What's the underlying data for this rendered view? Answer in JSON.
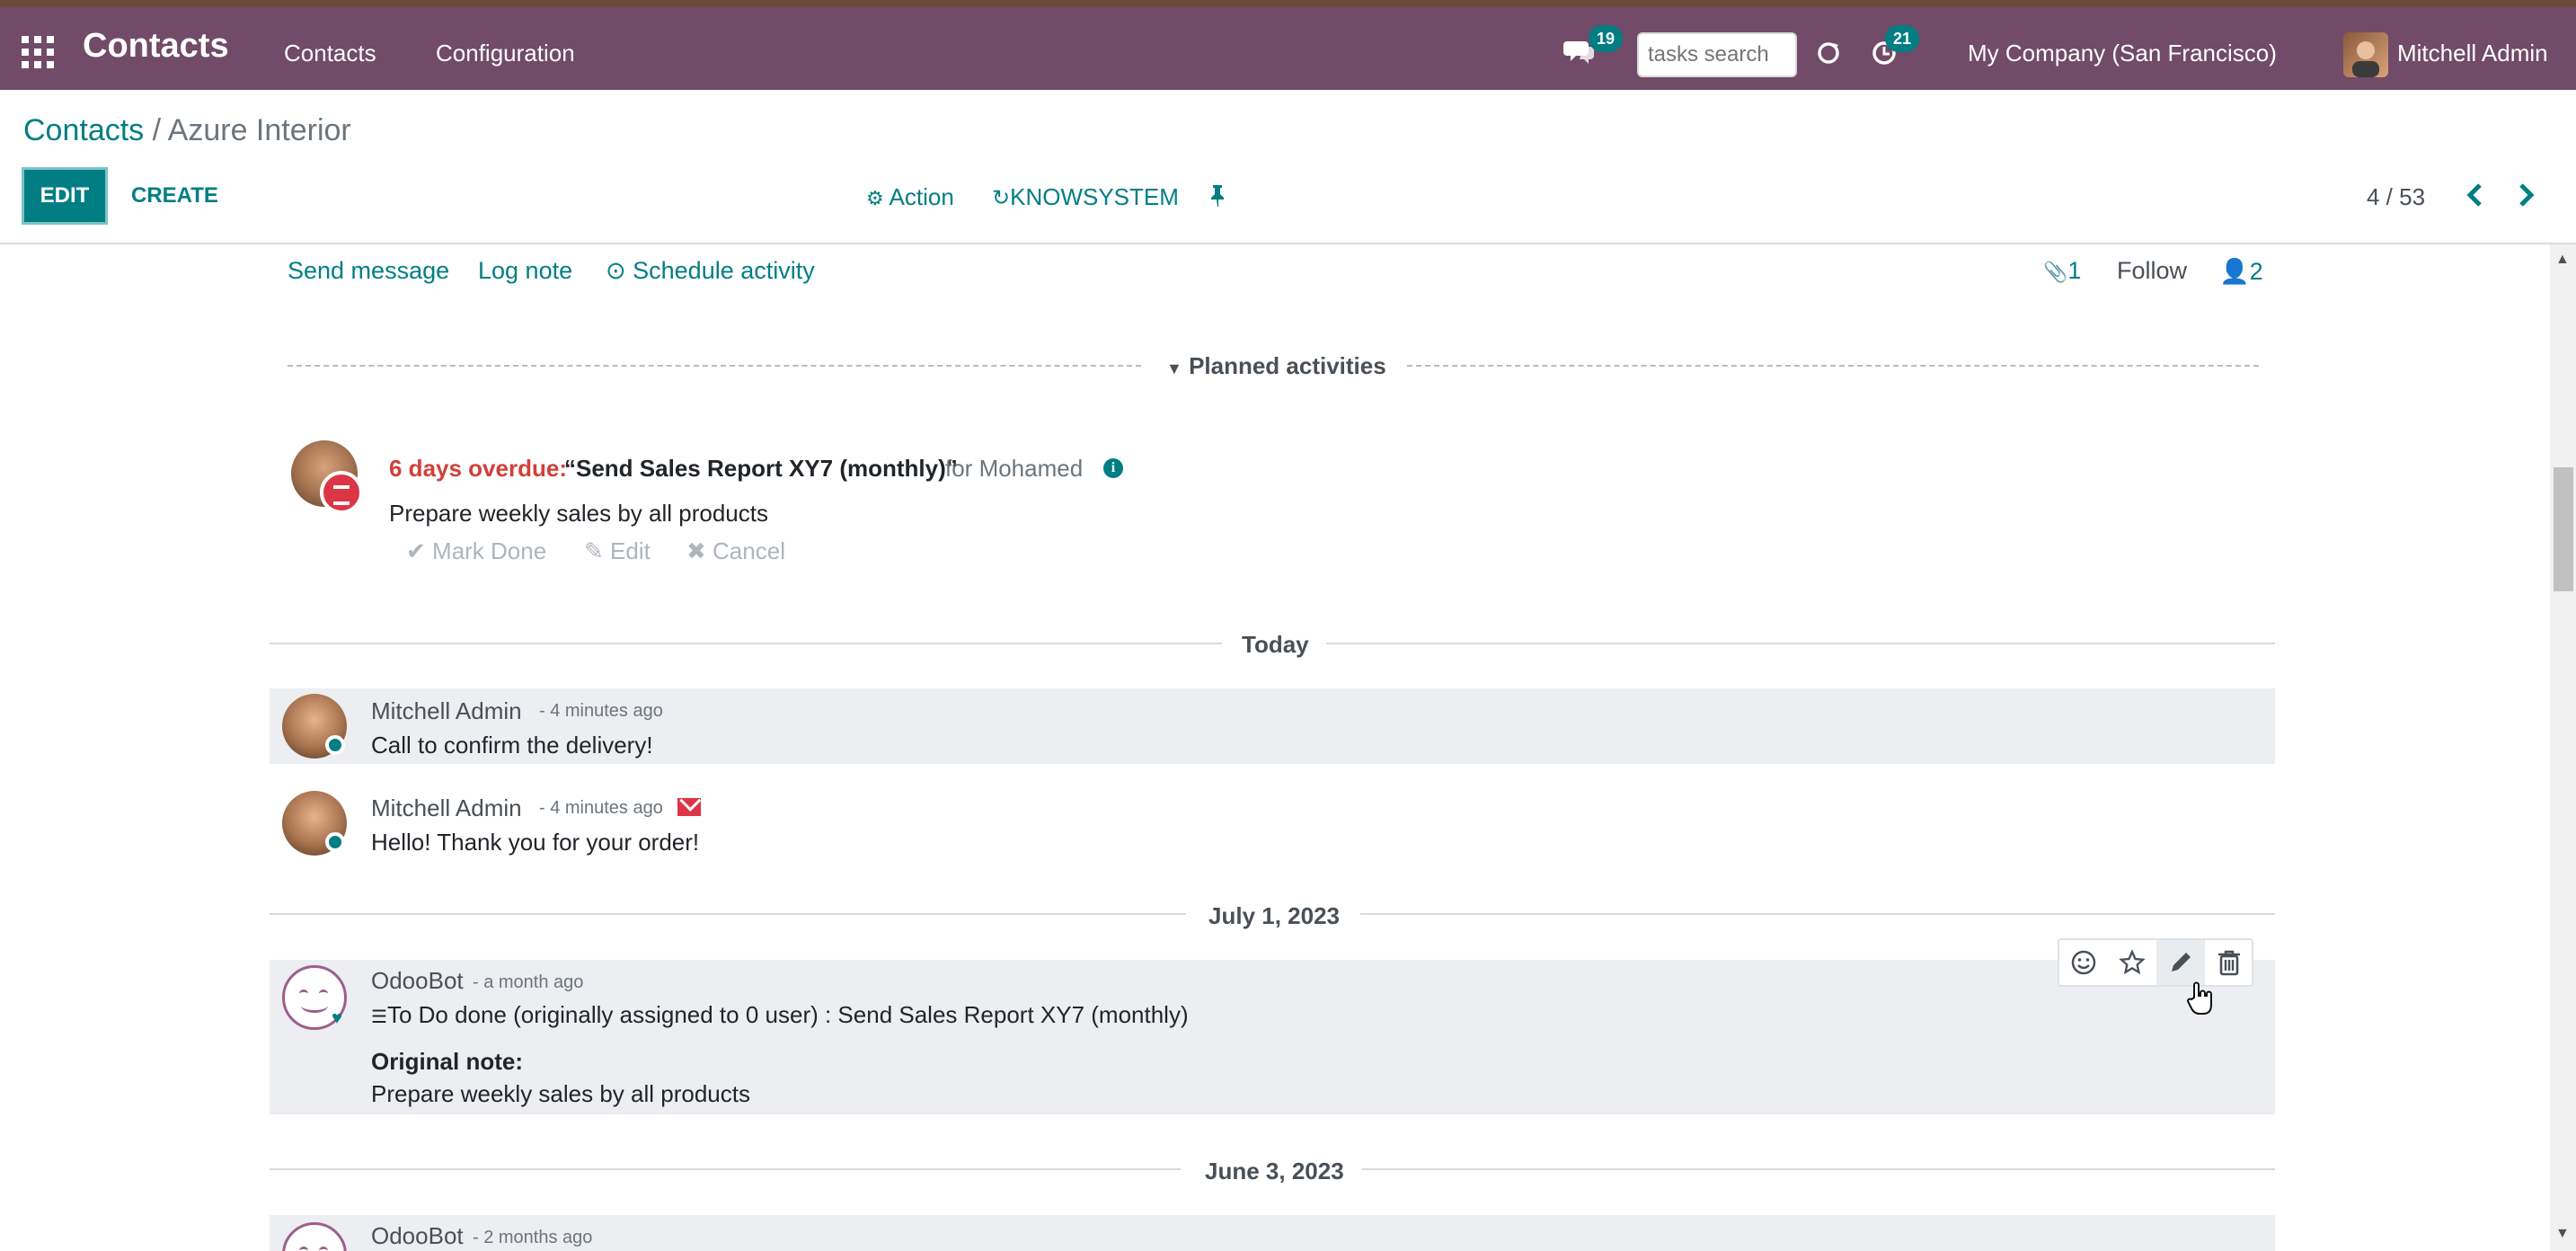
{
  "navbar": {
    "brand": "Contacts",
    "menu": [
      "Contacts",
      "Configuration"
    ],
    "chat_count": "19",
    "search_placeholder": "tasks search",
    "activity_count": "21",
    "company": "My Company (San Francisco)",
    "user": "Mitchell Admin"
  },
  "breadcrumb": {
    "root": "Contacts",
    "sep": "/",
    "current": "Azure Interior"
  },
  "toolbar": {
    "edit": "EDIT",
    "create": "CREATE",
    "action": "Action",
    "knowsystem": "KNOWSYSTEM",
    "pager": "4 / 53"
  },
  "chatter": {
    "send_message": "Send message",
    "log_note": "Log note",
    "schedule_activity": "Schedule activity",
    "attachments": "1",
    "follow": "Follow",
    "followers": "2"
  },
  "planned": {
    "title": "Planned activities",
    "overdue": "6 days overdue:",
    "summary": "“Send Sales Report XY7 (monthly)”",
    "for": "for Mohamed",
    "note": "Prepare weekly sales by all products",
    "mark_done": "Mark Done",
    "edit": "Edit",
    "cancel": "Cancel"
  },
  "dates": {
    "today": "Today",
    "july": "July 1, 2023",
    "june": "June 3, 2023"
  },
  "messages": [
    {
      "author": "Mitchell Admin",
      "when": "- 4 minutes ago",
      "body": "Call to confirm the delivery!"
    },
    {
      "author": "Mitchell Admin",
      "when": "- 4 minutes ago",
      "body": "Hello! Thank you for your order!"
    },
    {
      "author": "OdooBot",
      "when": "- a month ago",
      "body": "To Do done (originally assigned to 0 user) : Send Sales Report XY7 (monthly)",
      "label": "Original note:",
      "note": "Prepare weekly sales by all products"
    },
    {
      "author": "OdooBot",
      "when": "- 2 months ago"
    }
  ],
  "icons": {
    "apps": "apps-grid-icon",
    "chat": "chat-icon",
    "refresh": "refresh-icon",
    "activity": "clock-icon",
    "gear": "gear-icon",
    "pin": "pin-icon",
    "paperclip": "paperclip-icon",
    "user": "user-icon",
    "info": "info-icon",
    "email": "envelope-icon",
    "smile": "smile-icon",
    "star": "star-icon",
    "pencil": "pencil-icon",
    "trash": "trash-icon"
  },
  "colors": {
    "navbar": "#714b67",
    "accent": "#017e84",
    "overdue": "#d23f3a",
    "shaded_row": "#eceef1"
  }
}
